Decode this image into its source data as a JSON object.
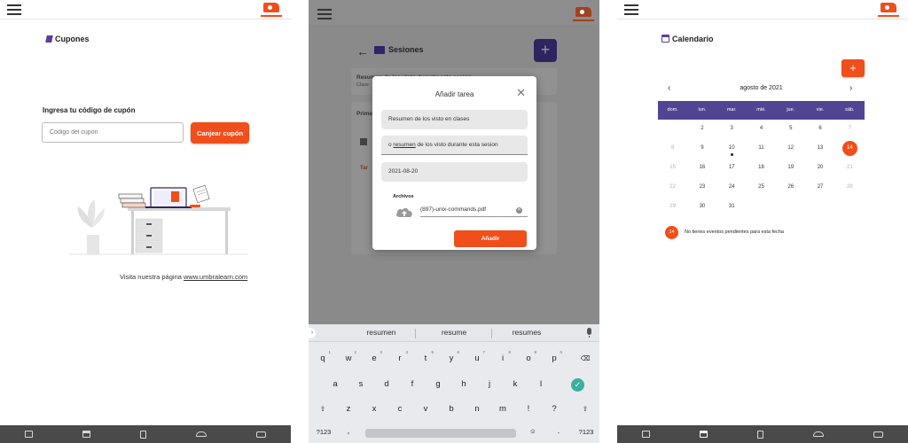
{
  "colors": {
    "accent": "#f04e1b",
    "brand_purple": "#514593",
    "nav_bar": "#4a4a4a"
  },
  "coupons": {
    "title": "Cupones",
    "prompt": "Ingresa tu código de cupón",
    "input_placeholder": "Código del cupón",
    "redeem_label": "Canjear cupón",
    "visit_text": "Visita nuestra página",
    "visit_link": "www.umbralearn.com"
  },
  "sessions": {
    "title": "Sesiones",
    "bg_card1_title": "Resumen de los visto durante esta sesion",
    "bg_card1_sub": "Clase",
    "bg_card2_title": "Primer",
    "bg_card2_tag": "Tar",
    "dialog": {
      "title": "Añadir tarea",
      "field_title": "Resumen de los visto en clases",
      "field_desc_prefix": "o ",
      "field_desc_underlined": "resumen",
      "field_desc_suffix": " de los visto durante esta sesion",
      "field_date": "2021-08-20",
      "files_label": "Archivos",
      "file_name": "(897)-unix-commands.pdf",
      "add_label": "Añadir"
    },
    "keyboard": {
      "suggestions": [
        "resumen",
        "resume",
        "resumes"
      ],
      "row1": [
        "q",
        "w",
        "e",
        "r",
        "t",
        "y",
        "u",
        "i",
        "o",
        "p"
      ],
      "row1_hints": [
        "1",
        "2",
        "3",
        "4",
        "5",
        "6",
        "7",
        "8",
        "9",
        "0"
      ],
      "row2": [
        "a",
        "s",
        "d",
        "f",
        "g",
        "h",
        "j",
        "k",
        "l"
      ],
      "row3": [
        "z",
        "x",
        "c",
        "v",
        "b",
        "n",
        "m",
        "!",
        "?"
      ],
      "symbols_label": "?123",
      "comma": ",",
      "period": "."
    }
  },
  "calendar": {
    "title": "Calendario",
    "month_label": "agosto de 2021",
    "weekdays": [
      "dom.",
      "lun.",
      "mar.",
      "mié.",
      "jue.",
      "vie.",
      "sáb."
    ],
    "legend_day": "14",
    "legend_text": "No tienes eventos pendientes para esta fecha",
    "weeks": [
      [
        {
          "d": "",
          "m": false
        },
        {
          "d": "2",
          "m": false
        },
        {
          "d": "3",
          "m": false
        },
        {
          "d": "4",
          "m": false
        },
        {
          "d": "5",
          "m": false
        },
        {
          "d": "6",
          "m": false
        },
        {
          "d": "7",
          "m": true
        }
      ],
      [
        {
          "d": "8",
          "m": true
        },
        {
          "d": "9",
          "m": false
        },
        {
          "d": "10",
          "m": false,
          "event": true
        },
        {
          "d": "11",
          "m": false
        },
        {
          "d": "12",
          "m": false
        },
        {
          "d": "13",
          "m": false
        },
        {
          "d": "14",
          "m": false,
          "today": true
        }
      ],
      [
        {
          "d": "15",
          "m": true
        },
        {
          "d": "16",
          "m": false
        },
        {
          "d": "17",
          "m": false
        },
        {
          "d": "18",
          "m": false
        },
        {
          "d": "19",
          "m": false
        },
        {
          "d": "20",
          "m": false
        },
        {
          "d": "21",
          "m": true
        }
      ],
      [
        {
          "d": "22",
          "m": true
        },
        {
          "d": "23",
          "m": false
        },
        {
          "d": "24",
          "m": false
        },
        {
          "d": "25",
          "m": false
        },
        {
          "d": "26",
          "m": false
        },
        {
          "d": "27",
          "m": false
        },
        {
          "d": "28",
          "m": true
        }
      ],
      [
        {
          "d": "29",
          "m": true
        },
        {
          "d": "30",
          "m": false
        },
        {
          "d": "31",
          "m": false
        },
        {
          "d": "",
          "m": false
        },
        {
          "d": "",
          "m": false
        },
        {
          "d": "",
          "m": false
        },
        {
          "d": "",
          "m": false
        }
      ]
    ]
  }
}
